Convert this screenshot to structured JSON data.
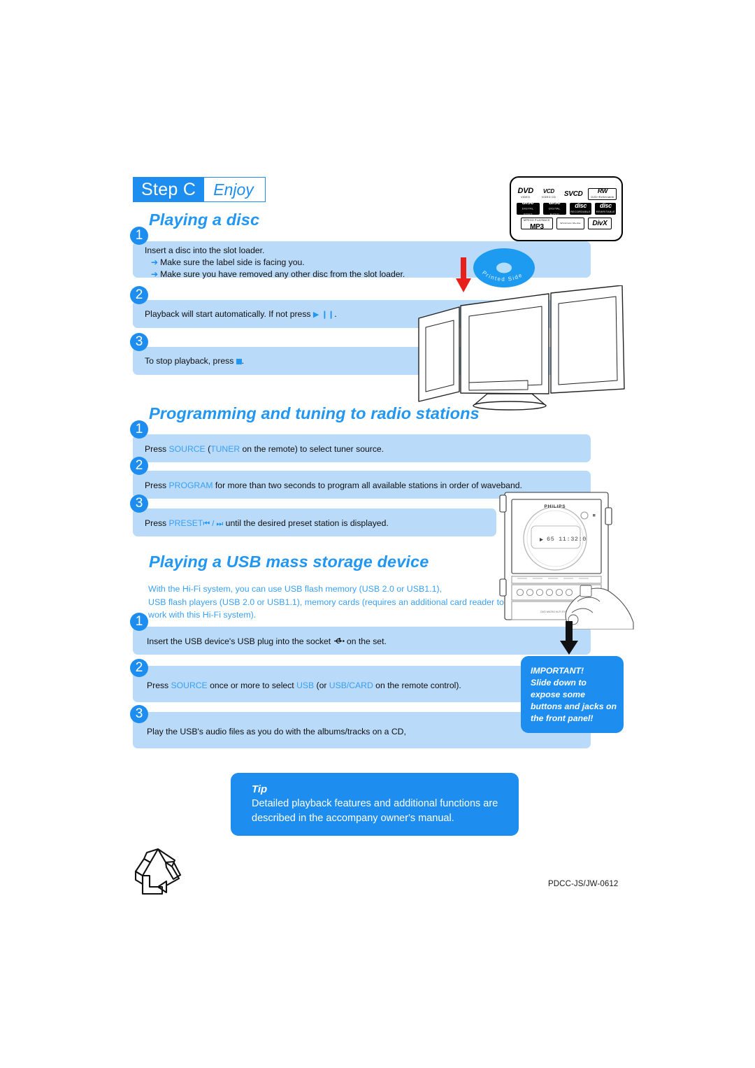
{
  "document": {
    "footer_code": "PDCC-JS/JW-0612"
  },
  "header": {
    "step_label": "Step C",
    "step_word": "Enjoy"
  },
  "sections": {
    "disc": {
      "title": "Playing a disc",
      "steps": [
        {
          "number": "1",
          "line1": "Insert a disc into the slot loader.",
          "line2": "Make sure the label side is facing you.",
          "line3": "Make sure you have removed any other disc from the slot loader."
        },
        {
          "number": "2",
          "text_before": "Playback will start automatically. If not press",
          "text_after": "."
        },
        {
          "number": "3",
          "text_before": "To stop playback, press",
          "text_after": "."
        }
      ]
    },
    "radio": {
      "title": "Programming and tuning to radio stations",
      "steps": [
        {
          "number": "1",
          "t1": "Press ",
          "k1": "SOURCE",
          "t2": " (",
          "k2": "TUNER",
          "t3": "  on the remote) to select tuner source."
        },
        {
          "number": "2",
          "t1": "Press ",
          "k1": "PROGRAM",
          "t2": "  for more than two seconds to program all available stations in order of waveband."
        },
        {
          "number": "3",
          "t1": "Press ",
          "k1": "PRESET",
          "t2": " until the desired preset station is displayed."
        }
      ]
    },
    "usb": {
      "title": "Playing a USB mass storage device",
      "intro": [
        " With the Hi-Fi system, you can use USB flash memory (USB 2.0 or USB1.1),",
        "USB flash players (USB 2.0 or USB1.1),  memory cards (requires an additional card reader  to",
        "work with this Hi-Fi system)."
      ],
      "steps": [
        {
          "number": "1",
          "t1": "Insert the USB device's USB plug into the socket",
          "t2": "on the set."
        },
        {
          "number": "2",
          "t1": "Press ",
          "k1": "SOURCE",
          "t2": " once or more to select ",
          "k2": "USB",
          "t3": " (or ",
          "k3": "USB/CARD",
          "t4": "  on the remote control)."
        },
        {
          "number": "3",
          "t1": "Play the USB's audio files as you do with the albums/tracks on a CD,"
        }
      ]
    }
  },
  "callouts": {
    "important": {
      "lines": [
        "IMPORTANT!",
        "Slide down to",
        "expose some",
        "buttons and jacks on",
        "the front panel!"
      ]
    },
    "tip": {
      "title": "Tip",
      "lines": [
        "Detailed playback features and additional functions are",
        "described in the accompany owner's manual."
      ]
    }
  },
  "graphics": {
    "disc_label": "Printed  Side",
    "brand_on_panel": "PHILIPS",
    "panel_display": "65  11:32:0",
    "format_logos": [
      {
        "main": "DVD",
        "sub": "VIDEO"
      },
      {
        "main": "VCD",
        "sub": "VIDEO CD"
      },
      {
        "main": "SVCD",
        "sub": ""
      },
      {
        "main": "RW",
        "sub": "DVD+ReWritable"
      },
      {
        "main": "disc",
        "sub": "DIGITAL VIDEO"
      },
      {
        "main": "disc",
        "sub": "DIGITAL AUDIO"
      },
      {
        "main": "disc",
        "sub": "RECORDABLE"
      },
      {
        "main": "disc",
        "sub": "REWRITABLE"
      },
      {
        "main": "MP3",
        "sub": "MPEG3 PLAYBACK"
      },
      {
        "main": "Windows Media",
        "sub": ""
      },
      {
        "main": "DivX",
        "sub": ""
      }
    ],
    "recycle_icon": "recycle-icon",
    "usb_socket_icon": "usb-icon",
    "play_icon": "play-icon",
    "pause_icon": "pause-icon",
    "stop_icon": "stop-icon",
    "prev_icon": "skip-previous-icon",
    "next_icon": "skip-next-icon"
  },
  "colors": {
    "brand_blue": "#1d8df0",
    "light_band": "#b9daf8",
    "key_blue": "#3aa0f5",
    "title_blue": "#2196f3",
    "red_arrow": "#e8201c"
  }
}
